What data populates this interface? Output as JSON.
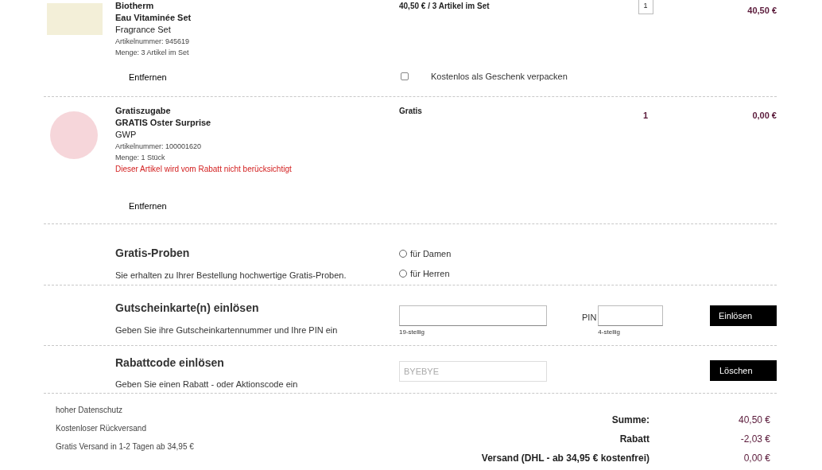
{
  "items": [
    {
      "kind": "set",
      "brand": "Biotherm",
      "name": "Eau Vitaminée Set",
      "type": "Fragrance Set",
      "article_number": "Artikelnummer: 945619",
      "quantity_label": "Menge: 3 Artikel im Set",
      "price": "40,50 € / 3 Artikel im Set",
      "qty": "1",
      "total": "40,50 €",
      "remove": "Entfernen",
      "gift_wrap": {
        "label": "Kostenlos als Geschenk verpacken",
        "checked": false
      }
    },
    {
      "kind": "gift",
      "brand": "Gratiszugabe",
      "name": "GRATIS Oster Surprise",
      "type": "GWP",
      "article_number": "Artikelnummer: 100001620",
      "quantity_label": "Menge: 1 Stück",
      "notice": "Dieser Artikel wird vom Rabatt nicht berücksichtigt",
      "price": "Gratis",
      "qty": "1",
      "total": "0,00 €",
      "remove": "Entfernen"
    }
  ],
  "samples": {
    "title": "Gratis-Proben",
    "description": "Sie erhalten zu Ihrer Bestellung hochwertige Gratis-Proben.",
    "options": [
      {
        "label": "für Damen",
        "selected": false
      },
      {
        "label": "für Herren",
        "selected": false
      }
    ]
  },
  "voucher": {
    "title": "Gutscheinkarte(n) einlösen",
    "description": "Geben Sie ihre Gutscheinkartennummer und Ihre PIN ein",
    "number_hint": "19-stellig",
    "pin_label": "PIN",
    "pin_hint": "4-stellig",
    "button": "Einlösen"
  },
  "discount": {
    "title": "Rabattcode einlösen",
    "description": "Geben Sie einen Rabatt - oder Aktionscode ein",
    "value": "BYEBYE",
    "button": "Löschen"
  },
  "benefits": [
    "hoher Datenschutz",
    "Kostenloser Rückversand",
    "Gratis Versand in 1-2 Tagen ab 34,95 €"
  ],
  "totals": [
    {
      "label": "Summe:",
      "value": "40,50 €"
    },
    {
      "label": "Rabatt",
      "value": "-2,03 €"
    },
    {
      "label": "Versand (DHL - ab 34,95 € kostenfrei)",
      "value": "0,00 €"
    }
  ]
}
